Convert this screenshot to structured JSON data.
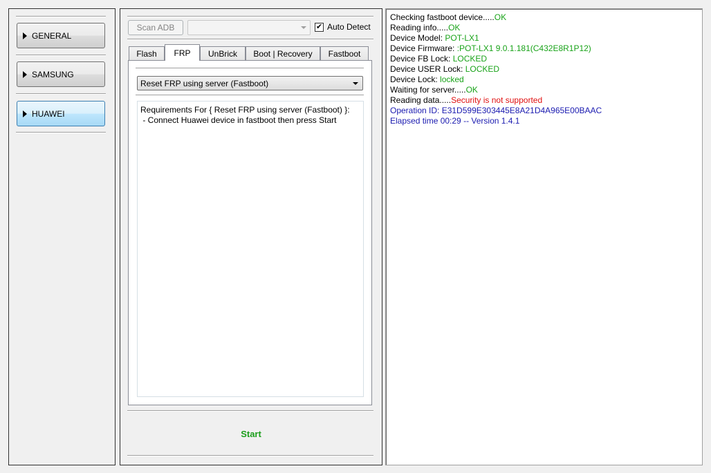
{
  "sidebar": {
    "items": [
      {
        "label": "GENERAL",
        "active": false
      },
      {
        "label": "SAMSUNG",
        "active": false
      },
      {
        "label": "HUAWEI",
        "active": true
      }
    ]
  },
  "toolbar": {
    "scan_label": "Scan ADB",
    "auto_detect_label": "Auto Detect",
    "auto_detect_checked": true
  },
  "tabs": [
    {
      "label": "Flash",
      "active": false
    },
    {
      "label": "FRP",
      "active": true
    },
    {
      "label": "UnBrick",
      "active": false
    },
    {
      "label": "Boot | Recovery",
      "active": false
    },
    {
      "label": "Fastboot",
      "active": false
    }
  ],
  "frp": {
    "selected_operation": "Reset FRP using server (Fastboot)",
    "requirements_title": "Requirements For { Reset FRP using server (Fastboot) }:",
    "requirements_line": " - Connect Huawei device in fastboot then press Start"
  },
  "start_label": "Start",
  "log": [
    {
      "text": "Checking fastboot device.....",
      "value": "OK",
      "value_color": "#19a319"
    },
    {
      "text": "Reading info.....",
      "value": "OK",
      "value_color": "#19a319"
    },
    {
      "text": "Device Model: ",
      "value": "POT-LX1",
      "value_color": "#19a319"
    },
    {
      "text": "Device Firmware: ",
      "value": ":POT-LX1 9.0.1.181(C432E8R1P12)",
      "value_color": "#19a319"
    },
    {
      "text": "Device FB Lock: ",
      "value": "LOCKED",
      "value_color": "#19a319"
    },
    {
      "text": "Device USER Lock: ",
      "value": "LOCKED",
      "value_color": "#19a319"
    },
    {
      "text": "Device Lock: ",
      "value": "locked",
      "value_color": "#19a319"
    },
    {
      "text": "Waiting for server.....",
      "value": "OK",
      "value_color": "#19a319"
    },
    {
      "text": "Reading data.....",
      "value": "Security is not supported",
      "value_color": "#e01010"
    },
    {
      "text": "Operation ID: E31D599E303445E8A21D4A965E00BAAC",
      "value": "",
      "value_color": "#1a1ab0",
      "text_color": "#1a1ab0"
    },
    {
      "text": "Elapsed time 00:29 -- Version 1.4.1",
      "value": "",
      "value_color": "#1a1ab0",
      "text_color": "#1a1ab0"
    }
  ]
}
